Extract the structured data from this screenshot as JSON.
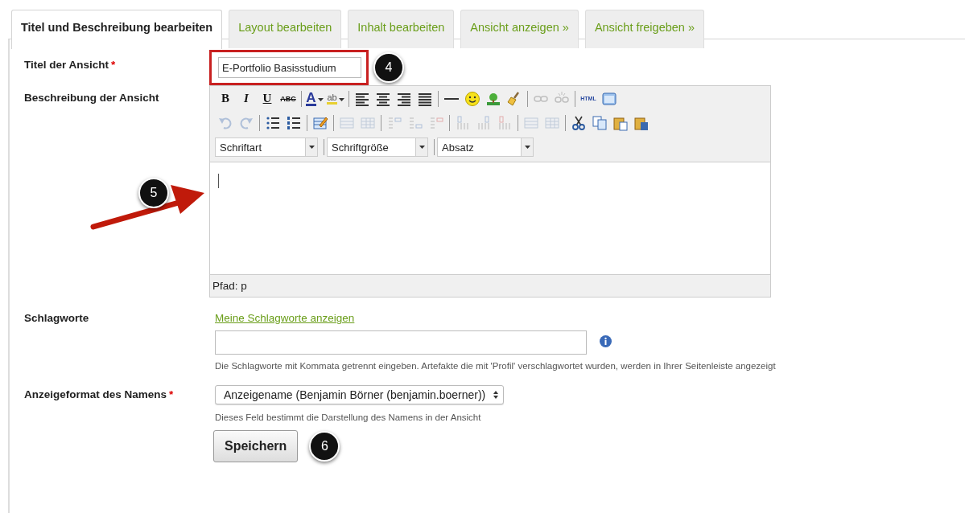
{
  "tabs": [
    {
      "label": "Titel und Beschreibung bearbeiten",
      "selected": true
    },
    {
      "label": "Layout bearbeiten",
      "selected": false
    },
    {
      "label": "Inhalt bearbeiten",
      "selected": false
    },
    {
      "label": "Ansicht anzeigen »",
      "selected": false
    },
    {
      "label": "Ansicht freigeben »",
      "selected": false
    }
  ],
  "form": {
    "title": {
      "label": "Titel der Ansicht",
      "required_mark": "*",
      "value": "E-Portfolio Basisstudium"
    },
    "description": {
      "label": "Beschreibung der Ansicht",
      "toolbar_rows": [
        [
          {
            "kind": "bold",
            "label": "B",
            "disabled": false
          },
          {
            "kind": "italic",
            "label": "I",
            "disabled": false
          },
          {
            "kind": "underline",
            "label": "U",
            "disabled": false
          },
          {
            "kind": "strike",
            "label": "ABC",
            "disabled": false
          },
          {
            "kind": "separator"
          },
          {
            "kind": "forecolor",
            "label": "A",
            "disabled": false
          },
          {
            "kind": "backcolor",
            "label": "ab",
            "disabled": false
          },
          {
            "kind": "separator"
          },
          {
            "kind": "align-left",
            "disabled": false
          },
          {
            "kind": "align-center",
            "disabled": false
          },
          {
            "kind": "align-right",
            "disabled": false
          },
          {
            "kind": "justify",
            "disabled": false
          },
          {
            "kind": "separator"
          },
          {
            "kind": "hr",
            "disabled": false
          },
          {
            "kind": "emoticon",
            "disabled": false
          },
          {
            "kind": "image",
            "disabled": false
          },
          {
            "kind": "cleanup",
            "disabled": false
          },
          {
            "kind": "separator"
          },
          {
            "kind": "link",
            "disabled": true
          },
          {
            "kind": "unlink",
            "disabled": true
          },
          {
            "kind": "separator"
          },
          {
            "kind": "html",
            "label": "HTML",
            "disabled": false
          },
          {
            "kind": "fullscreen",
            "disabled": false
          }
        ],
        [
          {
            "kind": "undo",
            "disabled": true
          },
          {
            "kind": "redo",
            "disabled": true
          },
          {
            "kind": "separator"
          },
          {
            "kind": "bullist",
            "disabled": false
          },
          {
            "kind": "numlist",
            "disabled": false
          },
          {
            "kind": "separator"
          },
          {
            "kind": "table",
            "disabled": false
          },
          {
            "kind": "separator"
          },
          {
            "kind": "row-props",
            "disabled": true
          },
          {
            "kind": "cell-props",
            "disabled": true
          },
          {
            "kind": "separator"
          },
          {
            "kind": "row-before",
            "disabled": true
          },
          {
            "kind": "row-after",
            "disabled": true
          },
          {
            "kind": "delete-row",
            "disabled": true
          },
          {
            "kind": "separator"
          },
          {
            "kind": "col-before",
            "disabled": true
          },
          {
            "kind": "col-after",
            "disabled": true
          },
          {
            "kind": "delete-col",
            "disabled": true
          },
          {
            "kind": "separator"
          },
          {
            "kind": "split",
            "disabled": true
          },
          {
            "kind": "merge",
            "disabled": true
          },
          {
            "kind": "separator"
          },
          {
            "kind": "cut",
            "disabled": false
          },
          {
            "kind": "copy",
            "disabled": false
          },
          {
            "kind": "paste",
            "disabled": false
          },
          {
            "kind": "paste-word",
            "disabled": false
          }
        ]
      ],
      "selects": [
        {
          "value": "Schriftart"
        },
        {
          "value": "Schriftgröße"
        },
        {
          "value": "Absatz"
        }
      ],
      "path": "Pfad: p"
    },
    "tags": {
      "label": "Schlagworte",
      "link": "Meine Schlagworte anzeigen",
      "hint": "Die Schlagworte mit Kommata getrennt eingeben. Artefakte die mit 'Profil' verschlagwortet wurden, werden in Ihrer Seitenleiste angezeigt"
    },
    "name_format": {
      "label": "Anzeigeformat des Namens",
      "required_mark": "*",
      "value": "Anzeigename (Benjamin Börner (benjamin.boerner))",
      "hint": "Dieses Feld bestimmt die Darstellung des Namens in der Ansicht"
    },
    "save_button": "Speichern"
  },
  "annotations": [
    {
      "number": "4"
    },
    {
      "number": "5"
    },
    {
      "number": "6"
    }
  ]
}
